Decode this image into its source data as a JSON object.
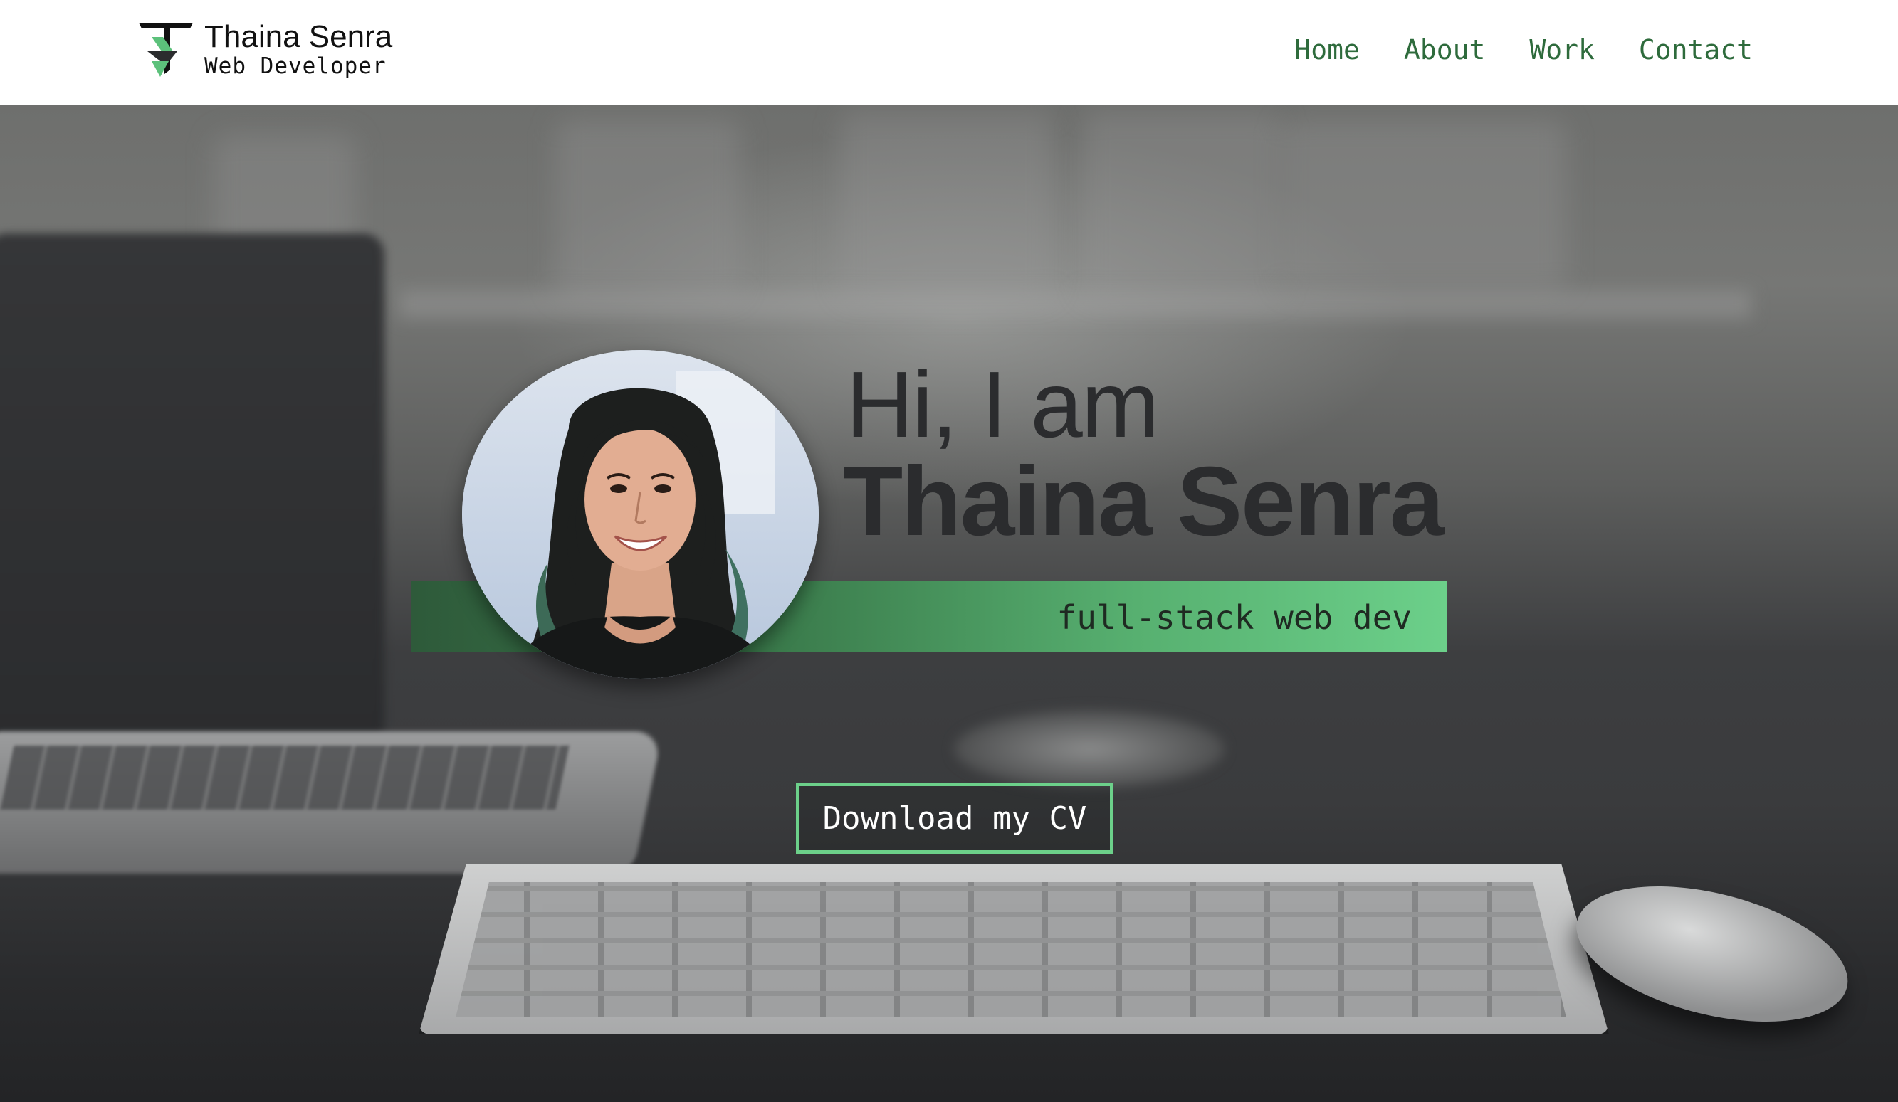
{
  "header": {
    "brand_name": "Thaina Senra",
    "brand_role": "Web Developer",
    "logo_icon": "ts-monogram-icon",
    "nav": [
      {
        "label": "Home"
      },
      {
        "label": "About"
      },
      {
        "label": "Work"
      },
      {
        "label": "Contact"
      }
    ]
  },
  "hero": {
    "greeting": "Hi, I am",
    "name": "Thaina Senra",
    "tagline": "full-stack web dev",
    "cta_label": "Download my CV",
    "avatar_icon": "profile-photo"
  },
  "colors": {
    "accent": "#6cd08a",
    "nav_text": "#2e6b3c",
    "heading_text": "#2b2c2e"
  }
}
